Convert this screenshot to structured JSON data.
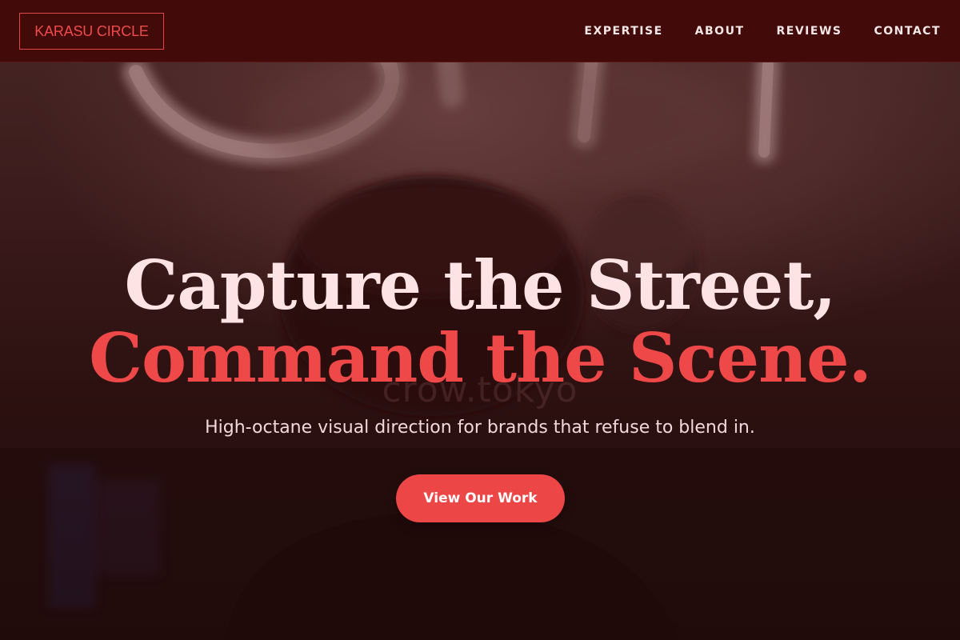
{
  "header": {
    "logo_text": "KARASU CIRCLE",
    "nav": [
      {
        "label": "EXPERTISE"
      },
      {
        "label": "ABOUT"
      },
      {
        "label": "REVIEWS"
      },
      {
        "label": "CONTACT"
      }
    ]
  },
  "hero": {
    "headline_line1": "Capture the Street,",
    "headline_line2": "Command the Scene.",
    "background_watermark": "crow.tokyo",
    "subheadline": "High-octane visual direction for brands that refuse to blend in.",
    "cta_label": "View Our Work"
  },
  "colors": {
    "header_bg": "#430a0a",
    "accent": "#ec4646",
    "headline_light": "#fde3e3"
  }
}
